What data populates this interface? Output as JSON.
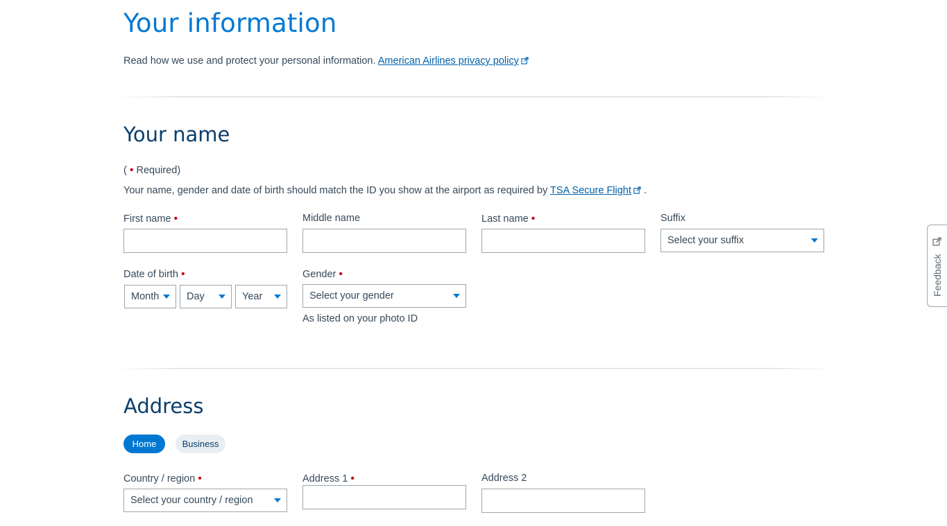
{
  "header": {
    "title": "Your information",
    "privacy_text": "Read how we use and protect your personal information.",
    "privacy_link": "American Airlines privacy policy"
  },
  "name_section": {
    "title": "Your name",
    "required_prefix": "(",
    "required_dot": "•",
    "required_suffix": "Required)",
    "match_note": "Your name, gender and date of birth should match the ID you show at the airport as required by",
    "tsa_link": "TSA Secure Flight",
    "match_end": ".",
    "fields": {
      "first_name_label": "First name",
      "middle_name_label": "Middle name",
      "last_name_label": "Last name",
      "suffix_label": "Suffix",
      "suffix_placeholder": "Select your suffix",
      "dob_label": "Date of birth",
      "month": "Month",
      "day": "Day",
      "year": "Year",
      "gender_label": "Gender",
      "gender_placeholder": "Select your gender",
      "gender_hint": "As listed on your photo ID"
    },
    "first_name_value": "",
    "middle_name_value": "",
    "last_name_value": ""
  },
  "address_section": {
    "title": "Address",
    "tabs": [
      "Home",
      "Business"
    ],
    "country_label": "Country / region",
    "country_placeholder": "Select your country / region",
    "address1_label": "Address 1",
    "address2_label": "Address 2",
    "address1_value": "",
    "address2_value": ""
  },
  "feedback": {
    "label": "Feedback"
  },
  "colors": {
    "accent": "#0078d2",
    "heading": "#0b3e6b",
    "required": "#c30019",
    "text": "#36495a"
  },
  "required_mark": "•"
}
